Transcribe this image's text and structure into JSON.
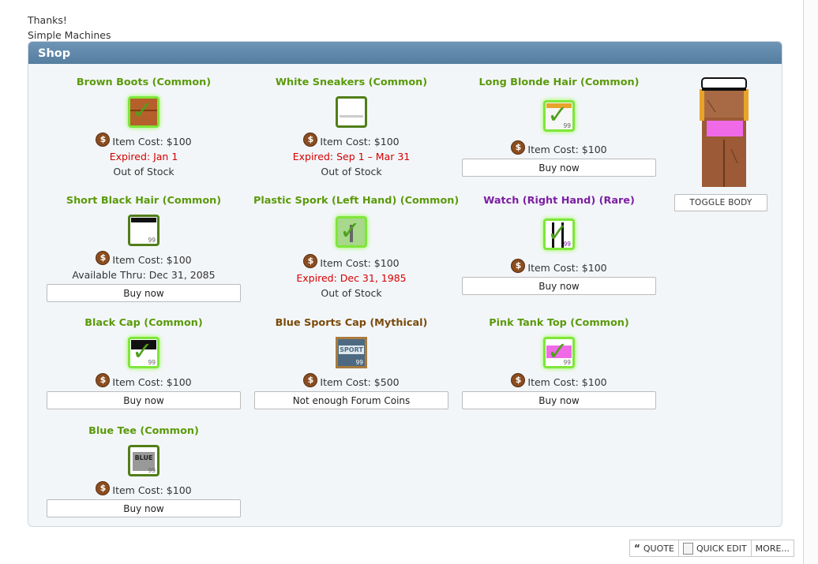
{
  "intro": {
    "line1": "Thanks!",
    "line2": "Simple Machines"
  },
  "shop": {
    "title": "Shop",
    "currency_icon": "dollar-coin-icon",
    "items": [
      {
        "name": "Brown Boots (Common)",
        "rarity_color": "#5a9a0a",
        "cost": "Item Cost: $100",
        "status_red": "Expired: Jan 1",
        "status": "Out of Stock"
      },
      {
        "name": "White Sneakers (Common)",
        "rarity_color": "#5a9a0a",
        "cost": "Item Cost: $100",
        "status_red": "Expired: Sep 1 – Mar 31",
        "status": "Out of Stock"
      },
      {
        "name": "Long Blonde Hair (Common)",
        "rarity_color": "#5a9a0a",
        "cost": "Item Cost: $100",
        "button": "Buy now",
        "qty": "99"
      },
      {
        "name": "Short Black Hair (Common)",
        "rarity_color": "#5a9a0a",
        "cost": "Item Cost: $100",
        "status": "Available Thru: Dec 31, 2085",
        "button": "Buy now",
        "qty": "99"
      },
      {
        "name": "Plastic Spork (Left Hand) (Common)",
        "rarity_color": "#5a9a0a",
        "cost": "Item Cost: $100",
        "status_red": "Expired: Dec 31, 1985",
        "status": "Out of Stock"
      },
      {
        "name": "Watch (Right Hand) (Rare)",
        "rarity_color": "#7b1fa2",
        "cost": "Item Cost: $100",
        "button": "Buy now",
        "qty": "99"
      },
      {
        "name": "Black Cap (Common)",
        "rarity_color": "#5a9a0a",
        "cost": "Item Cost: $100",
        "button": "Buy now",
        "qty": "99"
      },
      {
        "name": "Blue Sports Cap (Mythical)",
        "rarity_color": "#7a4a0a",
        "cost": "Item Cost: $500",
        "button": "Not enough Forum Coins",
        "thumb_text": "SPORT",
        "qty": "99"
      },
      {
        "name": "Pink Tank Top (Common)",
        "rarity_color": "#5a9a0a",
        "cost": "Item Cost: $100",
        "button": "Buy now",
        "qty": "99"
      },
      {
        "name": "Blue Tee (Common)",
        "rarity_color": "#5a9a0a",
        "cost": "Item Cost: $100",
        "button": "Buy now",
        "thumb_text": "BLUE",
        "qty": "99"
      }
    ],
    "toggle_body": "TOGGLE BODY"
  },
  "actions": {
    "quote": "QUOTE",
    "quick_edit": "QUICK EDIT",
    "more": "MORE..."
  }
}
